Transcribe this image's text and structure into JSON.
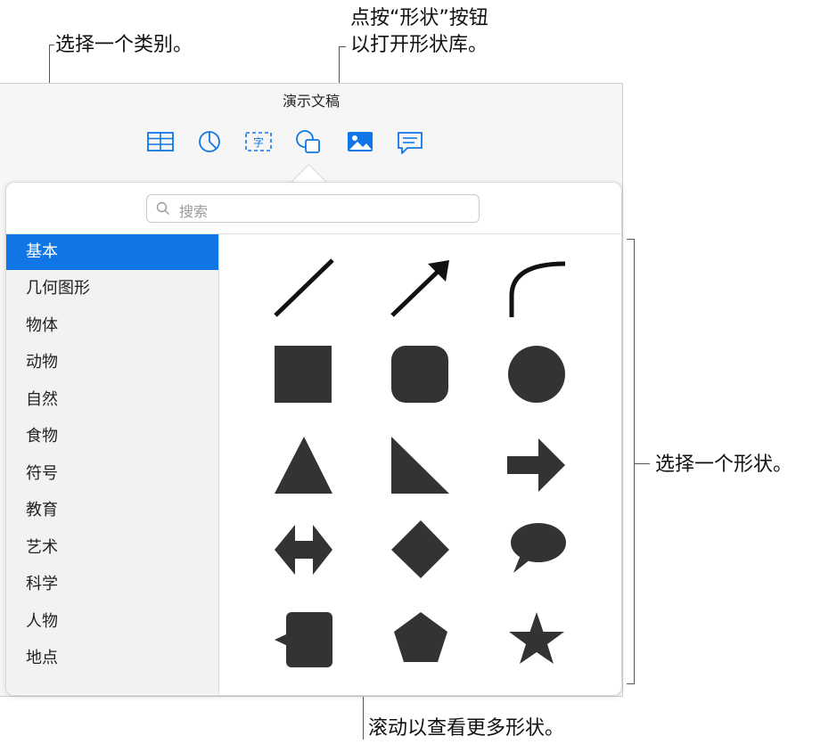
{
  "callouts": {
    "category": "选择一个类别。",
    "shapes_button": "点按“形状”按钮\n以打开形状库。",
    "choose_shape": "选择一个形状。",
    "scroll": "滚动以查看更多形状。"
  },
  "window": {
    "title": "演示文稿",
    "toolbar": [
      "table-icon",
      "chart-icon",
      "text-box-icon",
      "shape-icon",
      "media-icon",
      "comment-icon"
    ]
  },
  "search": {
    "placeholder": "搜索"
  },
  "categories": [
    {
      "label": "基本",
      "selected": true
    },
    {
      "label": "几何图形"
    },
    {
      "label": "物体"
    },
    {
      "label": "动物"
    },
    {
      "label": "自然"
    },
    {
      "label": "食物"
    },
    {
      "label": "符号"
    },
    {
      "label": "教育"
    },
    {
      "label": "艺术"
    },
    {
      "label": "科学"
    },
    {
      "label": "人物"
    },
    {
      "label": "地点"
    }
  ],
  "shapes": [
    "line",
    "arrow-line",
    "curve",
    "square",
    "rounded-square",
    "circle",
    "triangle",
    "right-triangle",
    "arrow-right",
    "double-arrow",
    "diamond",
    "speech-bubble",
    "callout-square",
    "pentagon",
    "star"
  ],
  "colors": {
    "accent": "#1176e5",
    "shape_fill": "#333333"
  }
}
